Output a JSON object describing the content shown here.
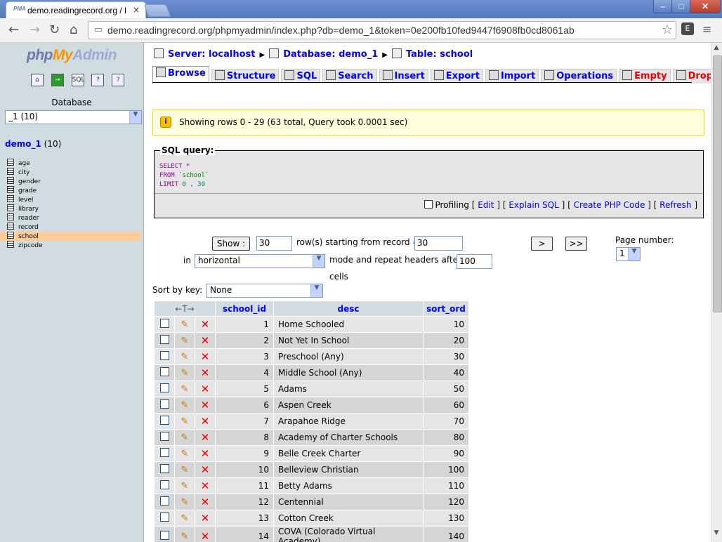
{
  "browser": {
    "tab_title": "demo.readingrecord.org / lo",
    "tab_close": "×",
    "favicon_text": "PMA",
    "url": "demo.readingrecord.org/phpmyadmin/index.php?db=demo_1&token=0e200fb10fed9447f6908fb0cd8061ab",
    "nav": {
      "back": "←",
      "forward": "→",
      "reload": "↻",
      "home": "⌂"
    },
    "star": "☆",
    "menu": "≡",
    "window": {
      "minimize": "–",
      "maximize": "□",
      "close": "✕"
    }
  },
  "left": {
    "logo": {
      "php": "php",
      "my": "My",
      "admin": "Admin"
    },
    "icons": [
      "home-icon",
      "exit-icon",
      "sql-icon",
      "docs-icon",
      "query-window-icon"
    ],
    "database_label": "Database",
    "database_select": "_1 (10)",
    "db_title": {
      "name": "demo_1",
      "count": " (10)"
    },
    "tables": [
      "age",
      "city",
      "gender",
      "grade",
      "level",
      "library",
      "reader",
      "record",
      "school",
      "zipcode"
    ],
    "active_table": "school"
  },
  "breadcrumb": {
    "server": "Server: localhost",
    "database": "Database: demo_1",
    "table": "Table: school"
  },
  "tabs": [
    {
      "label": "Browse",
      "active": true,
      "red": false
    },
    {
      "label": "Structure",
      "active": false,
      "red": false
    },
    {
      "label": "SQL",
      "active": false,
      "red": false
    },
    {
      "label": "Search",
      "active": false,
      "red": false
    },
    {
      "label": "Insert",
      "active": false,
      "red": false
    },
    {
      "label": "Export",
      "active": false,
      "red": false
    },
    {
      "label": "Import",
      "active": false,
      "red": false
    },
    {
      "label": "Operations",
      "active": false,
      "red": false
    },
    {
      "label": "Empty",
      "active": false,
      "red": true
    },
    {
      "label": "Drop",
      "active": false,
      "red": true
    }
  ],
  "notice": {
    "icon": "i",
    "text": "Showing rows 0 - 29 (63 total, Query took 0.0001 sec)"
  },
  "sql": {
    "legend": "SQL query:",
    "line1_kw": "SELECT",
    "line1_rest": " *",
    "line2_kw": "FROM",
    "line2_str": " `school`",
    "line3_kw": "LIMIT",
    "line3_num": " 0 , 30",
    "profiling": "Profiling",
    "links": [
      "Edit",
      "Explain SQL",
      "Create PHP Code",
      "Refresh"
    ]
  },
  "nav_form": {
    "show_button": "Show :",
    "rows_value": "30",
    "rows_label": "row(s) starting from record #",
    "start_value": "30",
    "in_label": "in",
    "mode_value": "horizontal",
    "mode_label": "mode and repeat headers after",
    "repeat_value": "100",
    "cells_label": "cells",
    "next_button": ">",
    "last_button": ">>",
    "page_number_label": "Page number:",
    "page_number_value": "1",
    "sort_label": "Sort by key:",
    "sort_value": "None"
  },
  "table": {
    "headers": {
      "arrows": "←T→",
      "school_id": "school_id",
      "desc": "desc",
      "sort_ord": "sort_ord"
    },
    "rows": [
      {
        "id": "1",
        "desc": "Home Schooled",
        "sort": "10"
      },
      {
        "id": "2",
        "desc": "Not Yet In School",
        "sort": "20"
      },
      {
        "id": "3",
        "desc": "Preschool (Any)",
        "sort": "30"
      },
      {
        "id": "4",
        "desc": "Middle School (Any)",
        "sort": "40"
      },
      {
        "id": "5",
        "desc": "Adams",
        "sort": "50"
      },
      {
        "id": "6",
        "desc": "Aspen Creek",
        "sort": "60"
      },
      {
        "id": "7",
        "desc": "Arapahoe Ridge",
        "sort": "70"
      },
      {
        "id": "8",
        "desc": "Academy of Charter Schools",
        "sort": "80"
      },
      {
        "id": "9",
        "desc": "Belle Creek Charter",
        "sort": "90"
      },
      {
        "id": "10",
        "desc": "Belleview Christian",
        "sort": "100"
      },
      {
        "id": "11",
        "desc": "Betty Adams",
        "sort": "110"
      },
      {
        "id": "12",
        "desc": "Centennial",
        "sort": "120"
      },
      {
        "id": "13",
        "desc": "Cotton Creek",
        "sort": "130"
      },
      {
        "id": "14",
        "desc": "COVA (Colorado Virtual Academy)",
        "sort": "140"
      }
    ]
  }
}
